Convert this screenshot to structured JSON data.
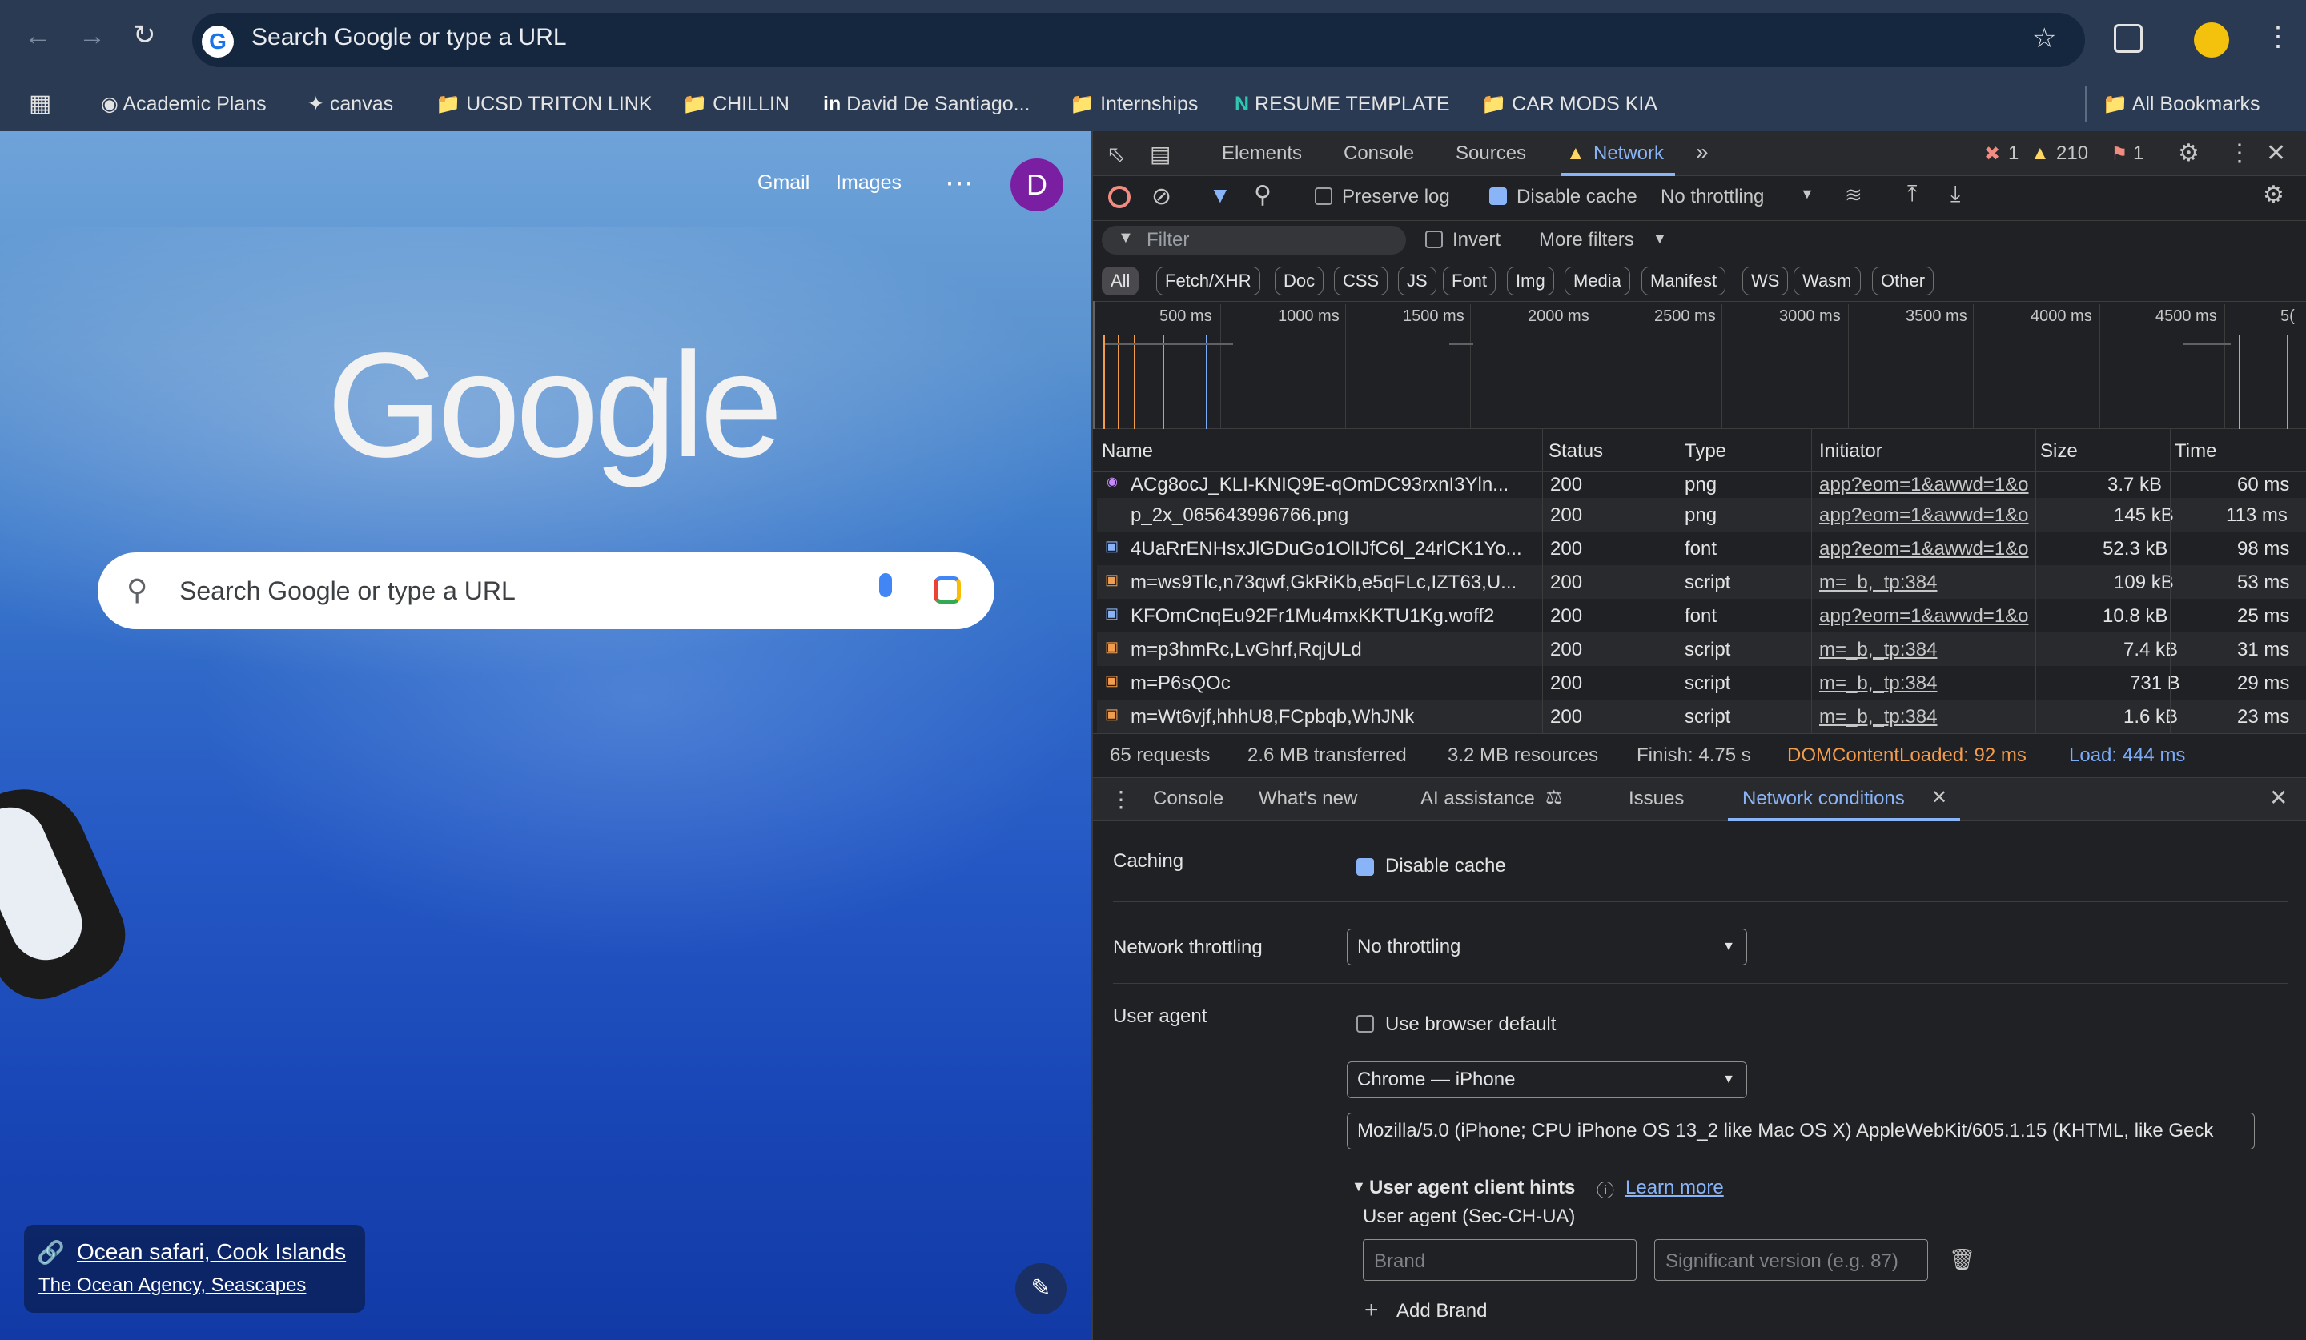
{
  "browser": {
    "omnibox_placeholder": "Search Google or type a URL",
    "bookmarks": [
      "Academic Plans",
      "canvas",
      "UCSD TRITON LINK",
      "CHILLIN",
      "David De Santiago...",
      "Internships",
      "RESUME TEMPLATE",
      "CAR MODS KIA"
    ],
    "all_bookmarks": "All Bookmarks"
  },
  "newtab": {
    "gmail": "Gmail",
    "images": "Images",
    "avatar": "D",
    "logo": "Google",
    "search_placeholder": "Search Google or type a URL",
    "attribution_title": "Ocean safari, Cook Islands",
    "attribution_sub": "The Ocean Agency, Seascapes"
  },
  "devtools": {
    "tabs": [
      "Elements",
      "Console",
      "Sources",
      "Network"
    ],
    "errors": "1",
    "warnings": "210",
    "issues": "1",
    "preserve_log": "Preserve log",
    "disable_cache": "Disable cache",
    "throttling": "No throttling",
    "filter_placeholder": "Filter",
    "invert": "Invert",
    "more_filters": "More filters",
    "type_filters": [
      "All",
      "Fetch/XHR",
      "Doc",
      "CSS",
      "JS",
      "Font",
      "Img",
      "Media",
      "Manifest",
      "WS",
      "Wasm",
      "Other"
    ],
    "timeline_ticks": [
      "500 ms",
      "1000 ms",
      "1500 ms",
      "2000 ms",
      "2500 ms",
      "3000 ms",
      "3500 ms",
      "4000 ms",
      "4500 ms",
      "5("
    ],
    "columns": [
      "Name",
      "Status",
      "Type",
      "Initiator",
      "Size",
      "Time"
    ],
    "rows": [
      {
        "name": "ACg8ocJ_KLI-KNIQ9E-qOmDC93rxnI3Yln...",
        "status": "200",
        "type": "png",
        "initiator": "app?eom=1&awwd=1&o",
        "size": "3.7 kB",
        "time": "60 ms"
      },
      {
        "name": "p_2x_065643996766.png",
        "status": "200",
        "type": "png",
        "initiator": "app?eom=1&awwd=1&o",
        "size": "145 kB",
        "time": "113 ms"
      },
      {
        "name": "4UaRrENHsxJlGDuGo1OlIJfC6l_24rlCK1Yo...",
        "status": "200",
        "type": "font",
        "initiator": "app?eom=1&awwd=1&o",
        "size": "52.3 kB",
        "time": "98 ms"
      },
      {
        "name": "m=ws9Tlc,n73qwf,GkRiKb,e5qFLc,IZT63,U...",
        "status": "200",
        "type": "script",
        "initiator": "m=_b,_tp:384",
        "size": "109 kB",
        "time": "53 ms"
      },
      {
        "name": "KFOmCnqEu92Fr1Mu4mxKKTU1Kg.woff2",
        "status": "200",
        "type": "font",
        "initiator": "app?eom=1&awwd=1&o",
        "size": "10.8 kB",
        "time": "25 ms"
      },
      {
        "name": "m=p3hmRc,LvGhrf,RqjULd",
        "status": "200",
        "type": "script",
        "initiator": "m=_b,_tp:384",
        "size": "7.4 kB",
        "time": "31 ms"
      },
      {
        "name": "m=P6sQOc",
        "status": "200",
        "type": "script",
        "initiator": "m=_b,_tp:384",
        "size": "731 B",
        "time": "29 ms"
      },
      {
        "name": "m=Wt6vjf,hhhU8,FCpbqb,WhJNk",
        "status": "200",
        "type": "script",
        "initiator": "m=_b,_tp:384",
        "size": "1.6 kB",
        "time": "23 ms"
      }
    ],
    "summary": {
      "requests": "65 requests",
      "transferred": "2.6 MB transferred",
      "resources": "3.2 MB resources",
      "finish": "Finish: 4.75 s",
      "dcl": "DOMContentLoaded: 92 ms",
      "load": "Load: 444 ms"
    },
    "drawer_tabs": [
      "Console",
      "What's new",
      "AI assistance",
      "Issues",
      "Network conditions"
    ],
    "conditions": {
      "caching_label": "Caching",
      "disable_cache": "Disable cache",
      "throttling_label": "Network throttling",
      "throttling_value": "No throttling",
      "ua_label": "User agent",
      "use_default": "Use browser default",
      "ua_select": "Chrome — iPhone",
      "ua_string": "Mozilla/5.0 (iPhone; CPU iPhone OS 13_2 like Mac OS X) AppleWebKit/605.1.15 (KHTML, like Geck",
      "hints_title": "User agent client hints",
      "learn_more": "Learn more",
      "sec_ch_ua": "User agent (Sec-CH-UA)",
      "brand_placeholder": "Brand",
      "version_placeholder": "Significant version (e.g. 87)",
      "add_brand": "Add Brand"
    }
  },
  "colors": {
    "accent": "#8ab4f8",
    "error": "#f28b82",
    "warning": "#fdd663",
    "dcl": "#f29c4d",
    "load": "#7cacf8",
    "avatar": "#7b1fa2"
  }
}
